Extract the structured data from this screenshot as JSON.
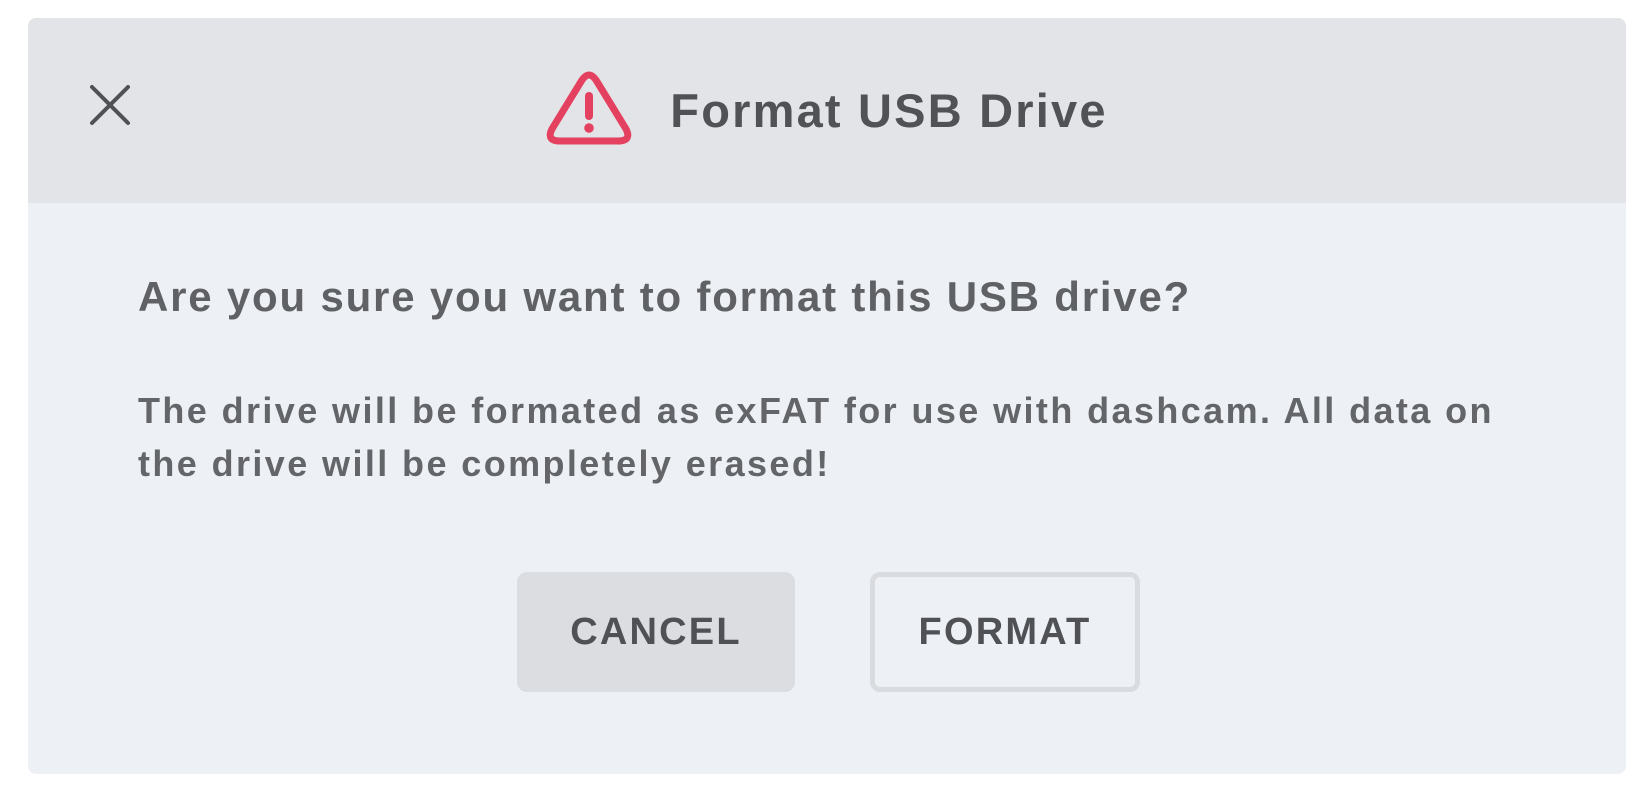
{
  "dialog": {
    "title": "Format USB Drive",
    "title_icon": "warning-triangle-icon",
    "close_icon": "close-icon",
    "question": "Are you sure you want to format this USB drive?",
    "description": "The drive will be formated as exFAT for use with dashcam. All data on the drive will be completely erased!",
    "buttons": {
      "cancel_label": "CANCEL",
      "format_label": "FORMAT"
    }
  },
  "colors": {
    "header_bg": "#e3e4e7",
    "body_bg": "#edf1f5",
    "warning": "#e3415f",
    "text": "#505255",
    "cancel_bg": "#dcdde0",
    "format_border": "#d9dbde"
  }
}
